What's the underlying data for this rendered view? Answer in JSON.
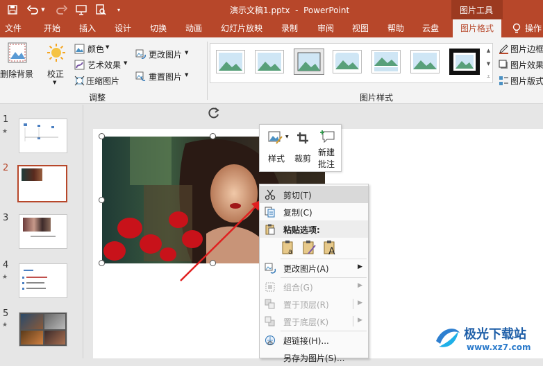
{
  "title_bar": {
    "doc_title": "演示文稿1.pptx  -  PowerPoint",
    "context_tab_group": "图片工具",
    "save_icon": "save-icon",
    "undo_icon": "undo-icon",
    "redo_icon": "redo-icon"
  },
  "tabs": [
    {
      "label": "文件"
    },
    {
      "label": "开始"
    },
    {
      "label": "插入"
    },
    {
      "label": "设计"
    },
    {
      "label": "切换"
    },
    {
      "label": "动画"
    },
    {
      "label": "幻灯片放映"
    },
    {
      "label": "录制"
    },
    {
      "label": "审阅"
    },
    {
      "label": "视图"
    },
    {
      "label": "帮助"
    },
    {
      "label": "云盘"
    },
    {
      "label": "图片格式"
    },
    {
      "label": "操作"
    }
  ],
  "ribbon": {
    "remove_bg": "删除背景",
    "correct": "校正",
    "color": "颜色",
    "artistic": "艺术效果",
    "compress": "压缩图片",
    "change_picture": "更改图片",
    "reset_picture": "重置图片",
    "adjust_group": "调整",
    "styles_group": "图片样式",
    "border": "图片边框",
    "effects": "图片效果",
    "layout": "图片版式"
  },
  "slides": [
    {
      "num": "1",
      "star": "★"
    },
    {
      "num": "2",
      "star": ""
    },
    {
      "num": "3",
      "star": ""
    },
    {
      "num": "4",
      "star": "★"
    },
    {
      "num": "5",
      "star": "★"
    }
  ],
  "mini_toolbar": {
    "style": "样式",
    "crop": "裁剪",
    "new_comment": "新建\n批注"
  },
  "context_menu": [
    {
      "label": "剪切(T)",
      "icon": "scissors-icon"
    },
    {
      "label": "复制(C)",
      "icon": "copy-icon"
    },
    {
      "label": "粘贴选项:",
      "icon": "paste-icon"
    },
    {
      "label": "更改图片(A)",
      "icon": "change-picture-icon"
    },
    {
      "label": "组合(G)",
      "icon": "group-icon"
    },
    {
      "label": "置于顶层(R)",
      "icon": "bring-front-icon"
    },
    {
      "label": "置于底层(K)",
      "icon": "send-back-icon"
    },
    {
      "label": "超链接(H)...",
      "icon": "link-icon"
    },
    {
      "label": "另存为图片(S)...",
      "icon": "save-picture-icon"
    }
  ],
  "watermark": {
    "title": "极光下载站",
    "url": "www.xz7.com"
  },
  "colors": {
    "accent": "#b7472a",
    "ribbon_bg": "#f3f3f3",
    "highlight": "#d9d9d9"
  }
}
